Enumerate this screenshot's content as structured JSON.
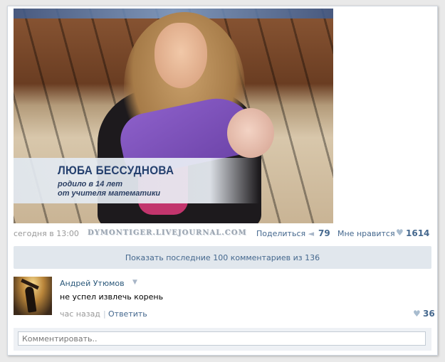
{
  "post": {
    "caption_name": "ЛЮБА БЕССУДНОВА",
    "caption_line1": "родило в 14 лет",
    "caption_line2": "от учителя математики",
    "date": "сегодня в 13:00",
    "watermark": "DYMONTIGER.LIVEJOURNAL.COM",
    "share_label": "Поделиться",
    "share_icon": "megaphone-icon",
    "share_count": "79",
    "like_label": "Мне нравится",
    "like_icon": "heart-icon",
    "like_count": "1614"
  },
  "comments_bar": {
    "label": "Показать последние 100 комментариев из 136"
  },
  "comment": {
    "author": "Андрей Утюмов",
    "text": "не успел извлечь корень",
    "time": "час назад",
    "reply_label": "Ответить",
    "like_count": "36"
  },
  "composer": {
    "placeholder": "Комментировать.."
  },
  "colors": {
    "link": "#45688e",
    "bar": "#e1e7ed",
    "muted": "#999999"
  }
}
